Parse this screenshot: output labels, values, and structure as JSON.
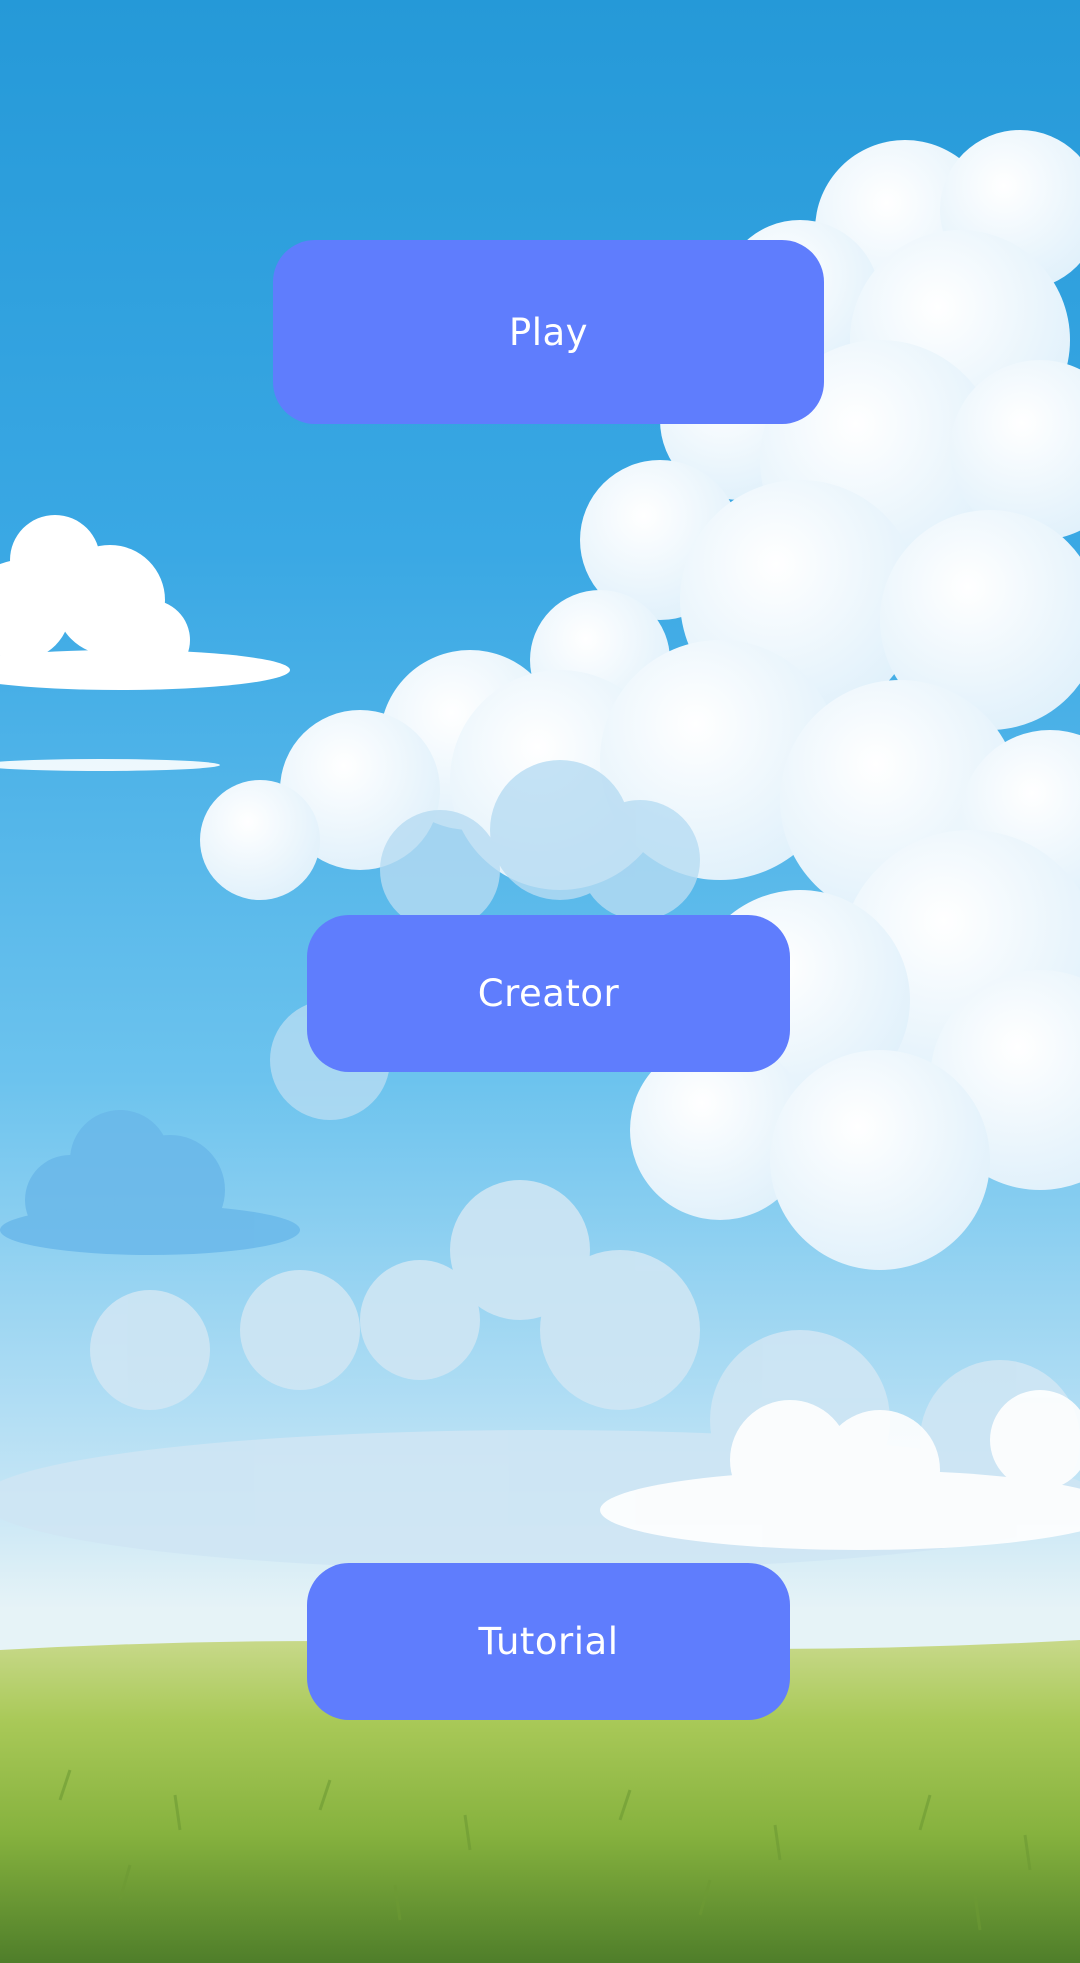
{
  "menu": {
    "play_label": "Play",
    "creator_label": "Creator",
    "tutorial_label": "Tutorial"
  },
  "colors": {
    "button_background": "#5f7dfd",
    "button_text": "#ffffff",
    "sky_top": "#2599d8",
    "sky_horizon": "#e6f3f7",
    "grass": "#9cc24a"
  },
  "background": {
    "scene": "cartoon-sky-with-clouds-and-grass-field"
  }
}
